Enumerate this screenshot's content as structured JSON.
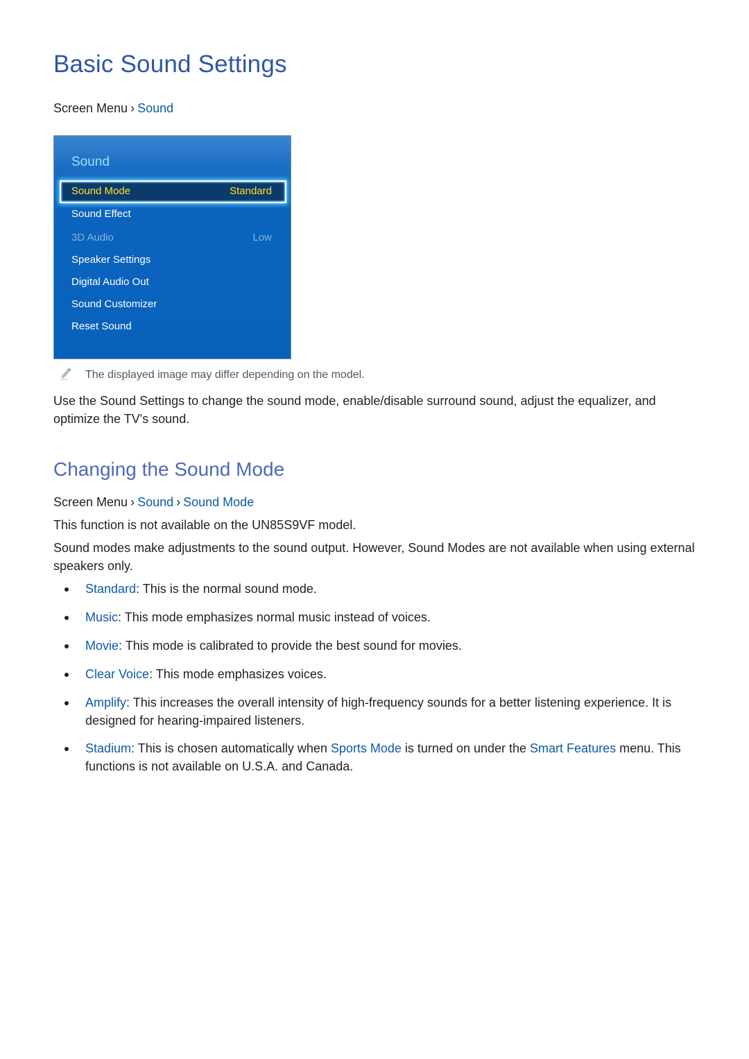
{
  "page": {
    "title": "Basic Sound Settings",
    "breadcrumb1": {
      "root": "Screen Menu",
      "items": [
        "Sound"
      ]
    },
    "tv_menu": {
      "title": "Sound",
      "items": [
        {
          "label": "Sound Mode",
          "value": "Standard",
          "state": "selected"
        },
        {
          "label": "Sound Effect",
          "value": "",
          "state": "normal"
        },
        {
          "label": "3D Audio",
          "value": "Low",
          "state": "disabled"
        },
        {
          "label": "Speaker Settings",
          "value": "",
          "state": "normal"
        },
        {
          "label": "Digital Audio Out",
          "value": "",
          "state": "normal"
        },
        {
          "label": "Sound Customizer",
          "value": "",
          "state": "normal"
        },
        {
          "label": "Reset Sound",
          "value": "",
          "state": "normal"
        }
      ]
    },
    "note": {
      "icon": "pencil-icon",
      "text": "The displayed image may differ depending on the model."
    },
    "intro": "Use the Sound Settings to change the sound mode, enable/disable surround sound, adjust the equalizer, and optimize the TV's sound.",
    "section": {
      "title": "Changing the Sound Mode",
      "breadcrumb": {
        "root": "Screen Menu",
        "items": [
          "Sound",
          "Sound Mode"
        ]
      },
      "availability": "This function is not available on the UN85S9VF model.",
      "description": "Sound modes make adjustments to the sound output. However, Sound Modes are not available when using external speakers only.",
      "modes": [
        {
          "name": "Standard",
          "text": ": This is the normal sound mode."
        },
        {
          "name": "Music",
          "text": ": This mode emphasizes normal music instead of voices."
        },
        {
          "name": "Movie",
          "text": ": This mode is calibrated to provide the best sound for movies."
        },
        {
          "name": "Clear Voice",
          "text": ": This mode emphasizes voices."
        },
        {
          "name": "Amplify",
          "text": ": This increases the overall intensity of high-frequency sounds for a better listening experience. It is designed for hearing-impaired listeners."
        },
        {
          "name": "Stadium",
          "text_a": ": This is chosen automatically when ",
          "link_a": "Sports Mode",
          "text_b": " is turned on under the ",
          "link_b": "Smart Features",
          "text_c": " menu. This functions is not available on U.S.A. and Canada."
        }
      ]
    },
    "colors": {
      "heading": "#2f56a6",
      "subheading": "#4f68b6",
      "link": "#0d5aa7",
      "menu_bg": "#0862bb",
      "menu_highlight_text": "#ffe12a",
      "menu_title": "#8fe6f5"
    }
  }
}
